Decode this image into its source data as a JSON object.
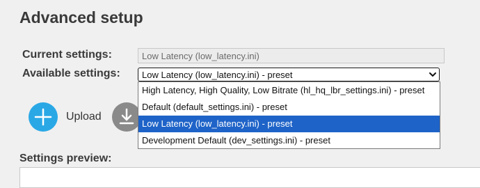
{
  "page": {
    "title": "Advanced setup"
  },
  "current_settings": {
    "label": "Current settings:",
    "value": "Low Latency (low_latency.ini)"
  },
  "available_settings": {
    "label": "Available settings:",
    "selected_value": "Low Latency (low_latency.ini) - preset",
    "options": [
      {
        "label": "High Latency, High Quality, Low Bitrate (hl_hq_lbr_settings.ini) - preset",
        "selected": false
      },
      {
        "label": "Default (default_settings.ini) - preset",
        "selected": false
      },
      {
        "label": "Low Latency (low_latency.ini) - preset",
        "selected": true
      },
      {
        "label": "Development Default (dev_settings.ini) - preset",
        "selected": false
      }
    ]
  },
  "actions": {
    "upload_label": "Upload",
    "upload_icon": "plus-icon",
    "download_icon": "download-icon"
  },
  "preview": {
    "heading": "Settings preview:"
  },
  "colors": {
    "upload_button": "#2aa8e6",
    "download_button": "#8a8a8a",
    "selected_option": "#1e63c8",
    "background": "#f0f0f0"
  }
}
